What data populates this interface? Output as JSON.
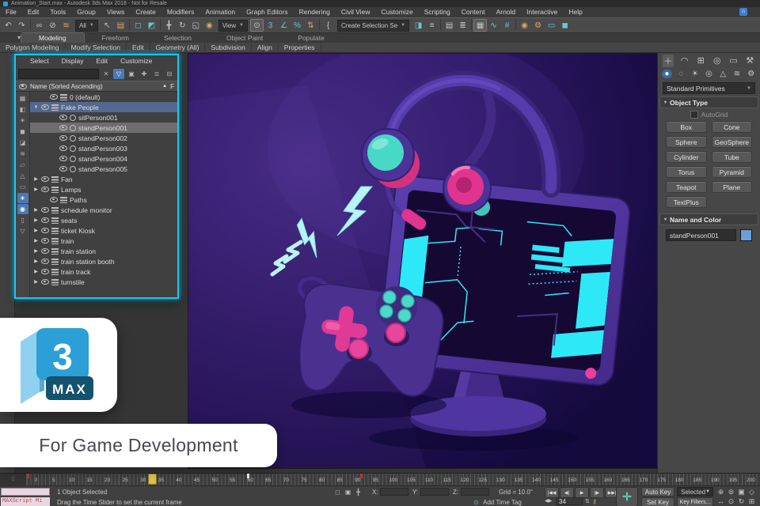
{
  "title_bar": {
    "title": "Animation_Start.max - Autodesk 3ds Max 2018  - Not for Resale"
  },
  "menu_bar": {
    "items": [
      "File",
      "Edit",
      "Tools",
      "Group",
      "Views",
      "Create",
      "Modifiers",
      "Animation",
      "Graph Editors",
      "Rendering",
      "Civil View",
      "Customize",
      "Scripting",
      "Content",
      "Arnold",
      "Interactive",
      "Help"
    ]
  },
  "toolbar": {
    "filter_dropdown": "All",
    "coord_dropdown": "View",
    "selection_set_dropdown": "Create Selection Se",
    "g1": [
      {
        "name": "undo-icon",
        "glyph": "↶"
      },
      {
        "name": "redo-icon",
        "glyph": "↷"
      },
      {
        "cls": "sep",
        "glyph": ""
      },
      {
        "name": "select-and-link-icon",
        "glyph": "∞"
      },
      {
        "name": "unlink-selection-icon",
        "glyph": "⊘"
      },
      {
        "name": "bind-to-space-warp-icon",
        "glyph": "≋",
        "cls": "gold"
      }
    ],
    "g2": [
      {
        "name": "select-object-icon",
        "glyph": "↖"
      },
      {
        "name": "select-by-name-icon",
        "glyph": "▤",
        "cls": "gold"
      },
      {
        "cls": "sep",
        "glyph": ""
      },
      {
        "name": "rectangular-selection-icon",
        "glyph": "◻",
        "cls": "teal"
      },
      {
        "name": "window-crossing-icon",
        "glyph": "◩",
        "cls": "teal"
      },
      {
        "cls": "sep",
        "glyph": ""
      },
      {
        "name": "select-and-move-icon",
        "glyph": "╋"
      },
      {
        "name": "select-and-rotate-icon",
        "glyph": "↻"
      },
      {
        "name": "select-and-scale-icon",
        "glyph": "◱"
      },
      {
        "name": "select-and-place-icon",
        "glyph": "◉",
        "cls": "gold"
      }
    ],
    "g3": [
      {
        "name": "use-pivot-center-icon",
        "glyph": "⊙",
        "cls": "boxed"
      },
      {
        "name": "snap-toggle-icon",
        "glyph": "3",
        "cls": "teal"
      },
      {
        "name": "angle-snap-icon",
        "glyph": "∠",
        "cls": "teal"
      },
      {
        "name": "percent-snap-icon",
        "glyph": "%",
        "cls": "teal"
      },
      {
        "name": "spinner-snap-icon",
        "glyph": "⇅",
        "cls": "gold"
      },
      {
        "cls": "sep",
        "glyph": ""
      },
      {
        "name": "named-selection-sets-icon",
        "glyph": "{"
      }
    ],
    "g4": [
      {
        "name": "mirror-icon",
        "glyph": "◨",
        "cls": "teal"
      },
      {
        "name": "align-icon",
        "glyph": "≡"
      },
      {
        "cls": "sep",
        "glyph": ""
      },
      {
        "name": "scene-explorer-icon",
        "glyph": "▤"
      },
      {
        "name": "layer-explorer-icon",
        "glyph": "≣"
      },
      {
        "cls": "sep",
        "glyph": ""
      },
      {
        "name": "ribbon-toggle-icon",
        "glyph": "▦",
        "cls": "boxed"
      },
      {
        "name": "curve-editor-icon",
        "glyph": "∿",
        "cls": "teal"
      },
      {
        "name": "schematic-view-icon",
        "glyph": "#",
        "cls": "teal"
      },
      {
        "cls": "sep",
        "glyph": ""
      },
      {
        "name": "material-editor-icon",
        "glyph": "◉",
        "cls": "gold"
      },
      {
        "name": "render-setup-icon",
        "glyph": "⚙",
        "cls": "gold"
      },
      {
        "name": "rendered-frame-icon",
        "glyph": "▭",
        "cls": "teal"
      },
      {
        "name": "render-production-icon",
        "glyph": "◼",
        "cls": "teal"
      }
    ]
  },
  "ribbon": {
    "tabs": [
      {
        "label": "Modeling",
        "cls": "active"
      },
      {
        "label": "Freeform"
      },
      {
        "label": "Selection"
      },
      {
        "label": "Object Paint"
      },
      {
        "label": "Populate"
      }
    ],
    "toggle_glyph": "▾",
    "panels": [
      "Polygon Modeling",
      "Modify Selection",
      "Edit",
      "Geometry (All)",
      "Subdivision",
      "Align",
      "Properties"
    ]
  },
  "scene_explorer": {
    "menu": [
      "Select",
      "Display",
      "Edit",
      "Customize"
    ],
    "tool_icons": [
      {
        "name": "clear-search-icon",
        "glyph": "✕"
      },
      {
        "name": "filter-funnel-icon",
        "glyph": "▽",
        "cls": "on"
      },
      {
        "name": "lock-explorer-icon",
        "glyph": "▣"
      },
      {
        "name": "pick-object-icon",
        "glyph": "✚"
      },
      {
        "name": "layers-mode-icon",
        "glyph": "≣"
      },
      {
        "name": "hierarchy-mode-icon",
        "glyph": "⊟"
      }
    ],
    "column_header": "Name (Sorted Ascending)",
    "sort_glyph": "▲",
    "header_right": "F",
    "side_icons": [
      {
        "name": "filter-all-icon",
        "glyph": "▦"
      },
      {
        "name": "filter-geometry-icon",
        "glyph": "◧"
      },
      {
        "name": "filter-lights-icon",
        "glyph": "☀"
      },
      {
        "name": "filter-cameras-icon",
        "glyph": "◼"
      },
      {
        "name": "filter-materials-icon",
        "glyph": "◪"
      },
      {
        "name": "filter-space-warps-icon",
        "glyph": "≋"
      },
      {
        "name": "filter-shapes-icon",
        "glyph": "▱"
      },
      {
        "name": "filter-helpers-icon",
        "glyph": "△"
      },
      {
        "name": "filter-groups-icon",
        "glyph": "▭"
      },
      {
        "name": "filter-bones-icon",
        "glyph": "∗",
        "cls": "on"
      },
      {
        "name": "show-hidden-icon",
        "glyph": "◉",
        "cls": "on"
      },
      {
        "name": "filter-frozen-icon",
        "glyph": "▯"
      },
      {
        "name": "filter-funnel-side-icon",
        "glyph": "▽"
      }
    ],
    "rows": [
      {
        "exp": "",
        "label": "0 (default)",
        "cls": "ind-1 k-layer"
      },
      {
        "exp": "▼",
        "label": "Fake People",
        "cls": "ind-0 k-layer sel-blue"
      },
      {
        "exp": "",
        "label": "sitPerson001",
        "cls": "ind-2 k-obj"
      },
      {
        "exp": "",
        "label": "standPerson001",
        "cls": "ind-2 k-obj sel-gray"
      },
      {
        "exp": "",
        "label": "standPerson002",
        "cls": "ind-2 k-obj"
      },
      {
        "exp": "",
        "label": "standPerson003",
        "cls": "ind-2 k-obj"
      },
      {
        "exp": "",
        "label": "standPerson004",
        "cls": "ind-2 k-obj"
      },
      {
        "exp": "",
        "label": "standPerson005",
        "cls": "ind-2 k-obj"
      },
      {
        "exp": "▶",
        "label": "Fan",
        "cls": "ind-0 k-layer"
      },
      {
        "exp": "▶",
        "label": "Lamps",
        "cls": "ind-0 k-layer"
      },
      {
        "exp": "",
        "label": "Paths",
        "cls": "ind-1 k-layer"
      },
      {
        "exp": "▶",
        "label": "schedule monitor",
        "cls": "ind-0 k-layer"
      },
      {
        "exp": "▶",
        "label": "seats",
        "cls": "ind-0 k-layer"
      },
      {
        "exp": "▶",
        "label": "ticket Kiosk",
        "cls": "ind-0 k-layer"
      },
      {
        "exp": "▶",
        "label": "train",
        "cls": "ind-0 k-layer"
      },
      {
        "exp": "▶",
        "label": "train station",
        "cls": "ind-0 k-layer"
      },
      {
        "exp": "▶",
        "label": "train station booth",
        "cls": "ind-0 k-layer"
      },
      {
        "exp": "▶",
        "label": "train track",
        "cls": "ind-0 k-layer"
      },
      {
        "exp": "▶",
        "label": "turnstile",
        "cls": "ind-0 k-layer"
      }
    ]
  },
  "command_panel": {
    "tabs": [
      {
        "name": "create-tab-icon",
        "glyph": "＋",
        "cls": "active"
      },
      {
        "name": "modify-tab-icon",
        "glyph": "◠"
      },
      {
        "name": "hierarchy-tab-icon",
        "glyph": "⊞"
      },
      {
        "name": "motion-tab-icon",
        "glyph": "◎"
      },
      {
        "name": "display-tab-icon",
        "glyph": "▭"
      },
      {
        "name": "utilities-tab-icon",
        "glyph": "⚒"
      }
    ],
    "sub_tabs": [
      {
        "name": "geometry-icon",
        "glyph": "●",
        "cls": "active-blue"
      },
      {
        "name": "shapes-icon",
        "glyph": "◌"
      },
      {
        "name": "lights-icon",
        "glyph": "☀"
      },
      {
        "name": "cameras-icon",
        "glyph": "◎"
      },
      {
        "name": "helpers-icon",
        "glyph": "△"
      },
      {
        "name": "space-warps-icon",
        "glyph": "≋"
      },
      {
        "name": "systems-icon",
        "glyph": "⚙"
      }
    ],
    "category_dropdown": "Standard Primitives",
    "object_type": {
      "title": "Object Type",
      "autogrid": "AutoGrid",
      "buttons": [
        "Box",
        "Cone",
        "Sphere",
        "GeoSphere",
        "Cylinder",
        "Tube",
        "Torus",
        "Pyramid",
        "Teapot",
        "Plane",
        "TextPlus"
      ]
    },
    "name_color": {
      "title": "Name and Color",
      "value": "standPerson001",
      "swatch_color": "#6a9fd8"
    }
  },
  "timeline": {
    "max": 200,
    "current_frame": 34,
    "labels": [
      "0",
      "5",
      "10",
      "15",
      "20",
      "25",
      "30",
      "35",
      "40",
      "45",
      "50",
      "55",
      "60",
      "65",
      "70",
      "75",
      "80",
      "85",
      "90",
      "95",
      "100",
      "105",
      "110",
      "115",
      "120",
      "125",
      "130",
      "135",
      "140",
      "145",
      "150",
      "155",
      "160",
      "165",
      "170",
      "175",
      "180",
      "185",
      "190",
      "195",
      "200"
    ],
    "markers": [
      {
        "frame": 0,
        "kind": "key"
      },
      {
        "frame": 33,
        "kind": "key"
      },
      {
        "frame": 60,
        "kind": "range"
      },
      {
        "frame": 91,
        "kind": "key"
      }
    ]
  },
  "status_bar": {
    "maxscript": "MAXScript Mi",
    "selection": "1 Object Selected",
    "prompt": "Drag the Time Slider to set the current frame",
    "trio": [
      {
        "name": "isolate-selection-icon",
        "glyph": "◻"
      },
      {
        "name": "selection-lock-icon",
        "glyph": "▣"
      },
      {
        "name": "transform-mode-icon",
        "glyph": "╋"
      }
    ],
    "x_label": "X:",
    "y_label": "Y:",
    "z_label": "Z:",
    "grid": "Grid = 10.0\"",
    "add_time_tag": "Add Time Tag",
    "playback": [
      {
        "name": "go-to-start-icon",
        "glyph": "|◀◀"
      },
      {
        "name": "previous-frame-icon",
        "glyph": "◀|"
      },
      {
        "name": "play-icon",
        "glyph": "▶"
      },
      {
        "name": "next-frame-icon",
        "glyph": "|▶"
      },
      {
        "name": "go-to-end-icon",
        "glyph": "▶▶|"
      }
    ],
    "frame": "34",
    "auto_key": "Auto Key",
    "set_key": "Set Key",
    "selected_dropdown": "Selected",
    "key_filters": "Key Filters...",
    "nav_icons": [
      {
        "name": "zoom-icon",
        "glyph": "⊕"
      },
      {
        "name": "zoom-all-icon",
        "glyph": "⊚"
      },
      {
        "name": "zoom-extents-icon",
        "glyph": "▣"
      },
      {
        "name": "field-of-view-icon",
        "glyph": "◇"
      },
      {
        "name": "pan-icon",
        "glyph": "↔"
      },
      {
        "name": "walk-through-icon",
        "glyph": "⊙"
      },
      {
        "name": "orbit-icon",
        "glyph": "↻"
      },
      {
        "name": "maximize-viewport-icon",
        "glyph": "⊞"
      }
    ]
  },
  "overlay": {
    "logo_number": "3",
    "logo_sub": "MAX",
    "caption": "For Game Development"
  },
  "viewport_colors": {
    "background": "#1d0f4a",
    "purple": "#4c3398",
    "magenta": "#e0348f",
    "teal": "#48d8c6",
    "cyan": "#2de9f7"
  }
}
